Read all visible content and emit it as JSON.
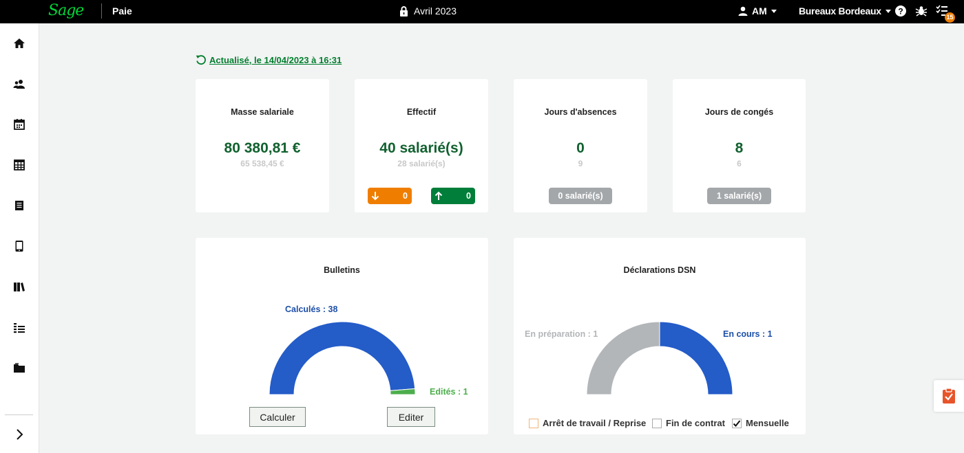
{
  "topbar": {
    "logo": "Sage",
    "app_name": "Paie",
    "period": "Avril 2023",
    "user": "AM",
    "company": "Bureaux Bordeaux",
    "notifications_count": "15"
  },
  "sidebar": {
    "items": [
      "home-icon",
      "employees-icon",
      "calendar-icon",
      "grid-icon",
      "book-icon",
      "tablet-icon",
      "library-icon",
      "list-icon",
      "folder-icon"
    ],
    "expand": "chevron-right-icon"
  },
  "refresh": {
    "label": "Actualisé, le 14/04/2023 à 16:31"
  },
  "kpis": [
    {
      "title": "Masse salariale",
      "value": "80 380,81 €",
      "previous": "65 538,45 €"
    },
    {
      "title": "Effectif",
      "value": "40 salarié(s)",
      "previous": "28 salarié(s)",
      "out": "0",
      "in": "0"
    },
    {
      "title": "Jours d'absences",
      "value": "0",
      "previous": "9",
      "pill": "0 salarié(s)"
    },
    {
      "title": "Jours de congés",
      "value": "8",
      "previous": "6",
      "pill": "1 salarié(s)"
    }
  ],
  "bulletins": {
    "title": "Bulletins",
    "label_calc": "Calculés : 38",
    "label_edit": "Edités : 1",
    "btn_calc": "Calculer",
    "btn_edit": "Editer"
  },
  "dsn": {
    "title": "Déclarations DSN",
    "label_prep": "En préparation : 1",
    "label_cours": "En cours : 1",
    "legend": [
      {
        "label": "Arrêt de travail / Reprise",
        "checked": false
      },
      {
        "label": "Fin de contrat",
        "checked": false
      },
      {
        "label": "Mensuelle",
        "checked": true
      }
    ]
  },
  "chart_data": [
    {
      "type": "pie",
      "title": "Bulletins",
      "categories": [
        "Calculés",
        "Edités"
      ],
      "values": [
        38,
        1
      ],
      "colors": [
        "#245cc8",
        "#4cae4c"
      ]
    },
    {
      "type": "pie",
      "title": "Déclarations DSN",
      "categories": [
        "En préparation",
        "En cours"
      ],
      "values": [
        1,
        1
      ],
      "colors": [
        "#b3b6b9",
        "#245cc8"
      ]
    }
  ],
  "colors": {
    "accent": "#007e2d",
    "value": "#11612f",
    "blue": "#245cc8",
    "orange": "#ef7e00"
  }
}
